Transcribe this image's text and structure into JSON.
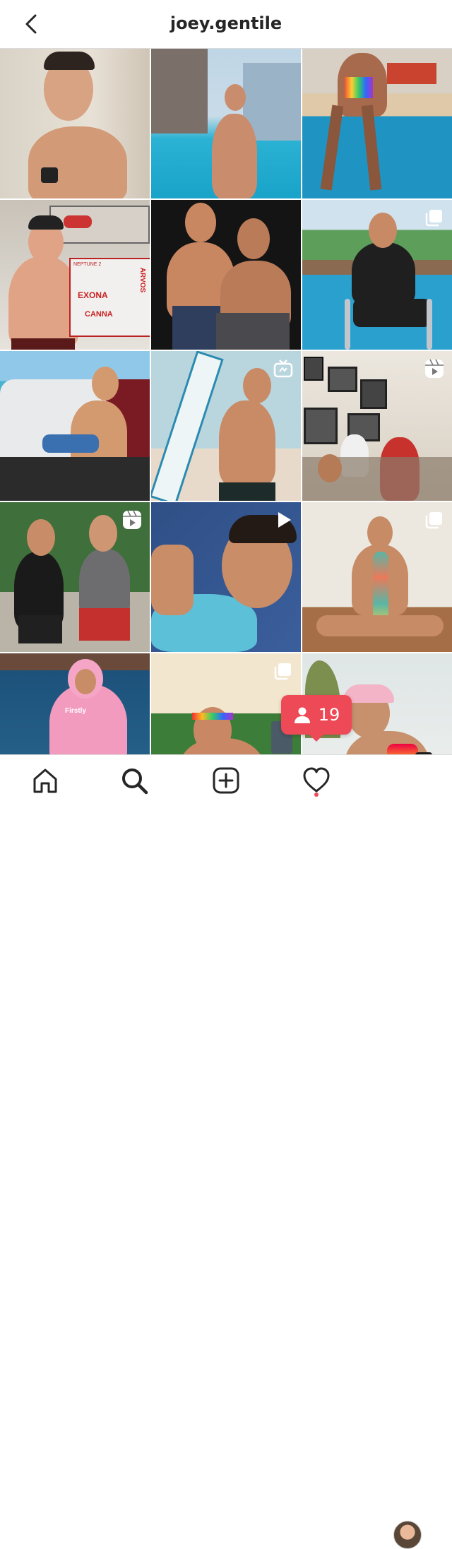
{
  "header": {
    "username": "joey.gentile",
    "back_icon": "chevron-left-icon"
  },
  "grid": {
    "posts": [
      {
        "id": "post-1",
        "badge": null
      },
      {
        "id": "post-2",
        "badge": null
      },
      {
        "id": "post-3",
        "badge": null
      },
      {
        "id": "post-4",
        "badge": null
      },
      {
        "id": "post-5",
        "badge": null
      },
      {
        "id": "post-6",
        "badge": "carousel-icon"
      },
      {
        "id": "post-7",
        "badge": null
      },
      {
        "id": "post-8",
        "badge": "igtv-icon"
      },
      {
        "id": "post-9",
        "badge": "reels-icon"
      },
      {
        "id": "post-10",
        "badge": "reels-icon"
      },
      {
        "id": "post-11",
        "badge": "play-icon"
      },
      {
        "id": "post-12",
        "badge": "carousel-icon"
      },
      {
        "id": "post-13",
        "badge": null
      },
      {
        "id": "post-14",
        "badge": "carousel-icon"
      },
      {
        "id": "post-15",
        "badge": null
      }
    ],
    "box_labels": [
      "NEPTUNE 2",
      "EXONA",
      "CANNA",
      "ARVOS"
    ],
    "hoodie_text": "Firstly"
  },
  "notification": {
    "count": "19",
    "icon": "person-icon",
    "color": "#ed4956"
  },
  "tabbar": {
    "items": [
      "home-icon",
      "search-icon",
      "new-post-icon",
      "activity-heart-icon",
      "profile-avatar"
    ],
    "active": "search-icon"
  }
}
